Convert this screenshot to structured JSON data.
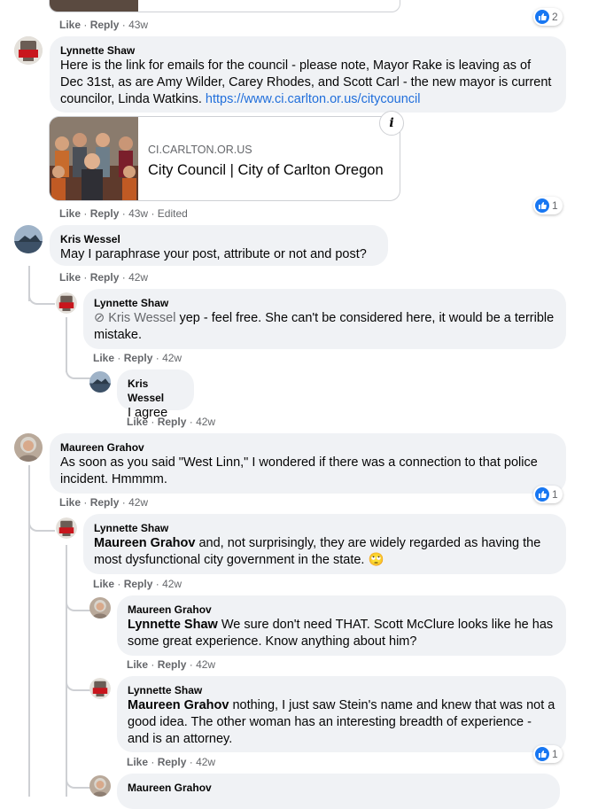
{
  "actions": {
    "like": "Like",
    "reply": "Reply",
    "sep": "·"
  },
  "comments": [
    {
      "author": "",
      "time": "43w",
      "reactions": "2"
    },
    {
      "author": "Lynnette Shaw",
      "text": "Here is the link for emails for the council - please note, Mayor Rake is leaving as of Dec 31st, as are Amy Wilder, Carey Rhodes, and Scott Carl - the new mayor is current councilor, Linda Watkins.",
      "link": "https://www.ci.carlton.or.us/citycouncil",
      "preview": {
        "domain": "CI.CARLTON.OR.US",
        "title": "City Council | City of Carlton Oregon",
        "info": "i"
      },
      "time": "43w",
      "edited": "Edited",
      "reactions": "1"
    },
    {
      "author": "Kris Wessel",
      "text": "May I paraphrase your post, attribute or not and post?",
      "time": "42w"
    },
    {
      "author": "Lynnette Shaw",
      "mention": "Kris Wessel",
      "text": " yep - feel free. She can't be considered here, it would be a terrible mistake.",
      "time": "42w"
    },
    {
      "author": "Kris Wessel",
      "text": "I agree",
      "time": "42w"
    },
    {
      "author": "Maureen Grahov",
      "text": "As soon as you said \"West Linn,\" I wondered if there was a connection to that police incident. Hmmmm.",
      "time": "42w",
      "reactions": "1"
    },
    {
      "author": "Lynnette Shaw",
      "mention": "Maureen Grahov",
      "text": " and, not surprisingly, they are widely regarded as having the most dysfunctional city government in the state.",
      "emoji": "🙄",
      "time": "42w"
    },
    {
      "author": "Maureen Grahov",
      "mention": "Lynnette Shaw",
      "text": " We sure don't need THAT. Scott McClure looks like he has some great experience. Know anything about him?",
      "time": "42w"
    },
    {
      "author": "Lynnette Shaw",
      "mention": "Maureen Grahov",
      "text": " nothing, I just saw Stein's name and knew that was not a good idea. The other woman has an interesting breadth of experience - and is an attorney.",
      "time": "42w",
      "reactions": "1"
    },
    {
      "author": "Maureen Grahov"
    }
  ],
  "avatar_badge": "Recall",
  "colors": {
    "like_blue": "#1877f2",
    "link": "#216fdb",
    "bubble": "#f0f2f5",
    "meta": "#65676b"
  }
}
